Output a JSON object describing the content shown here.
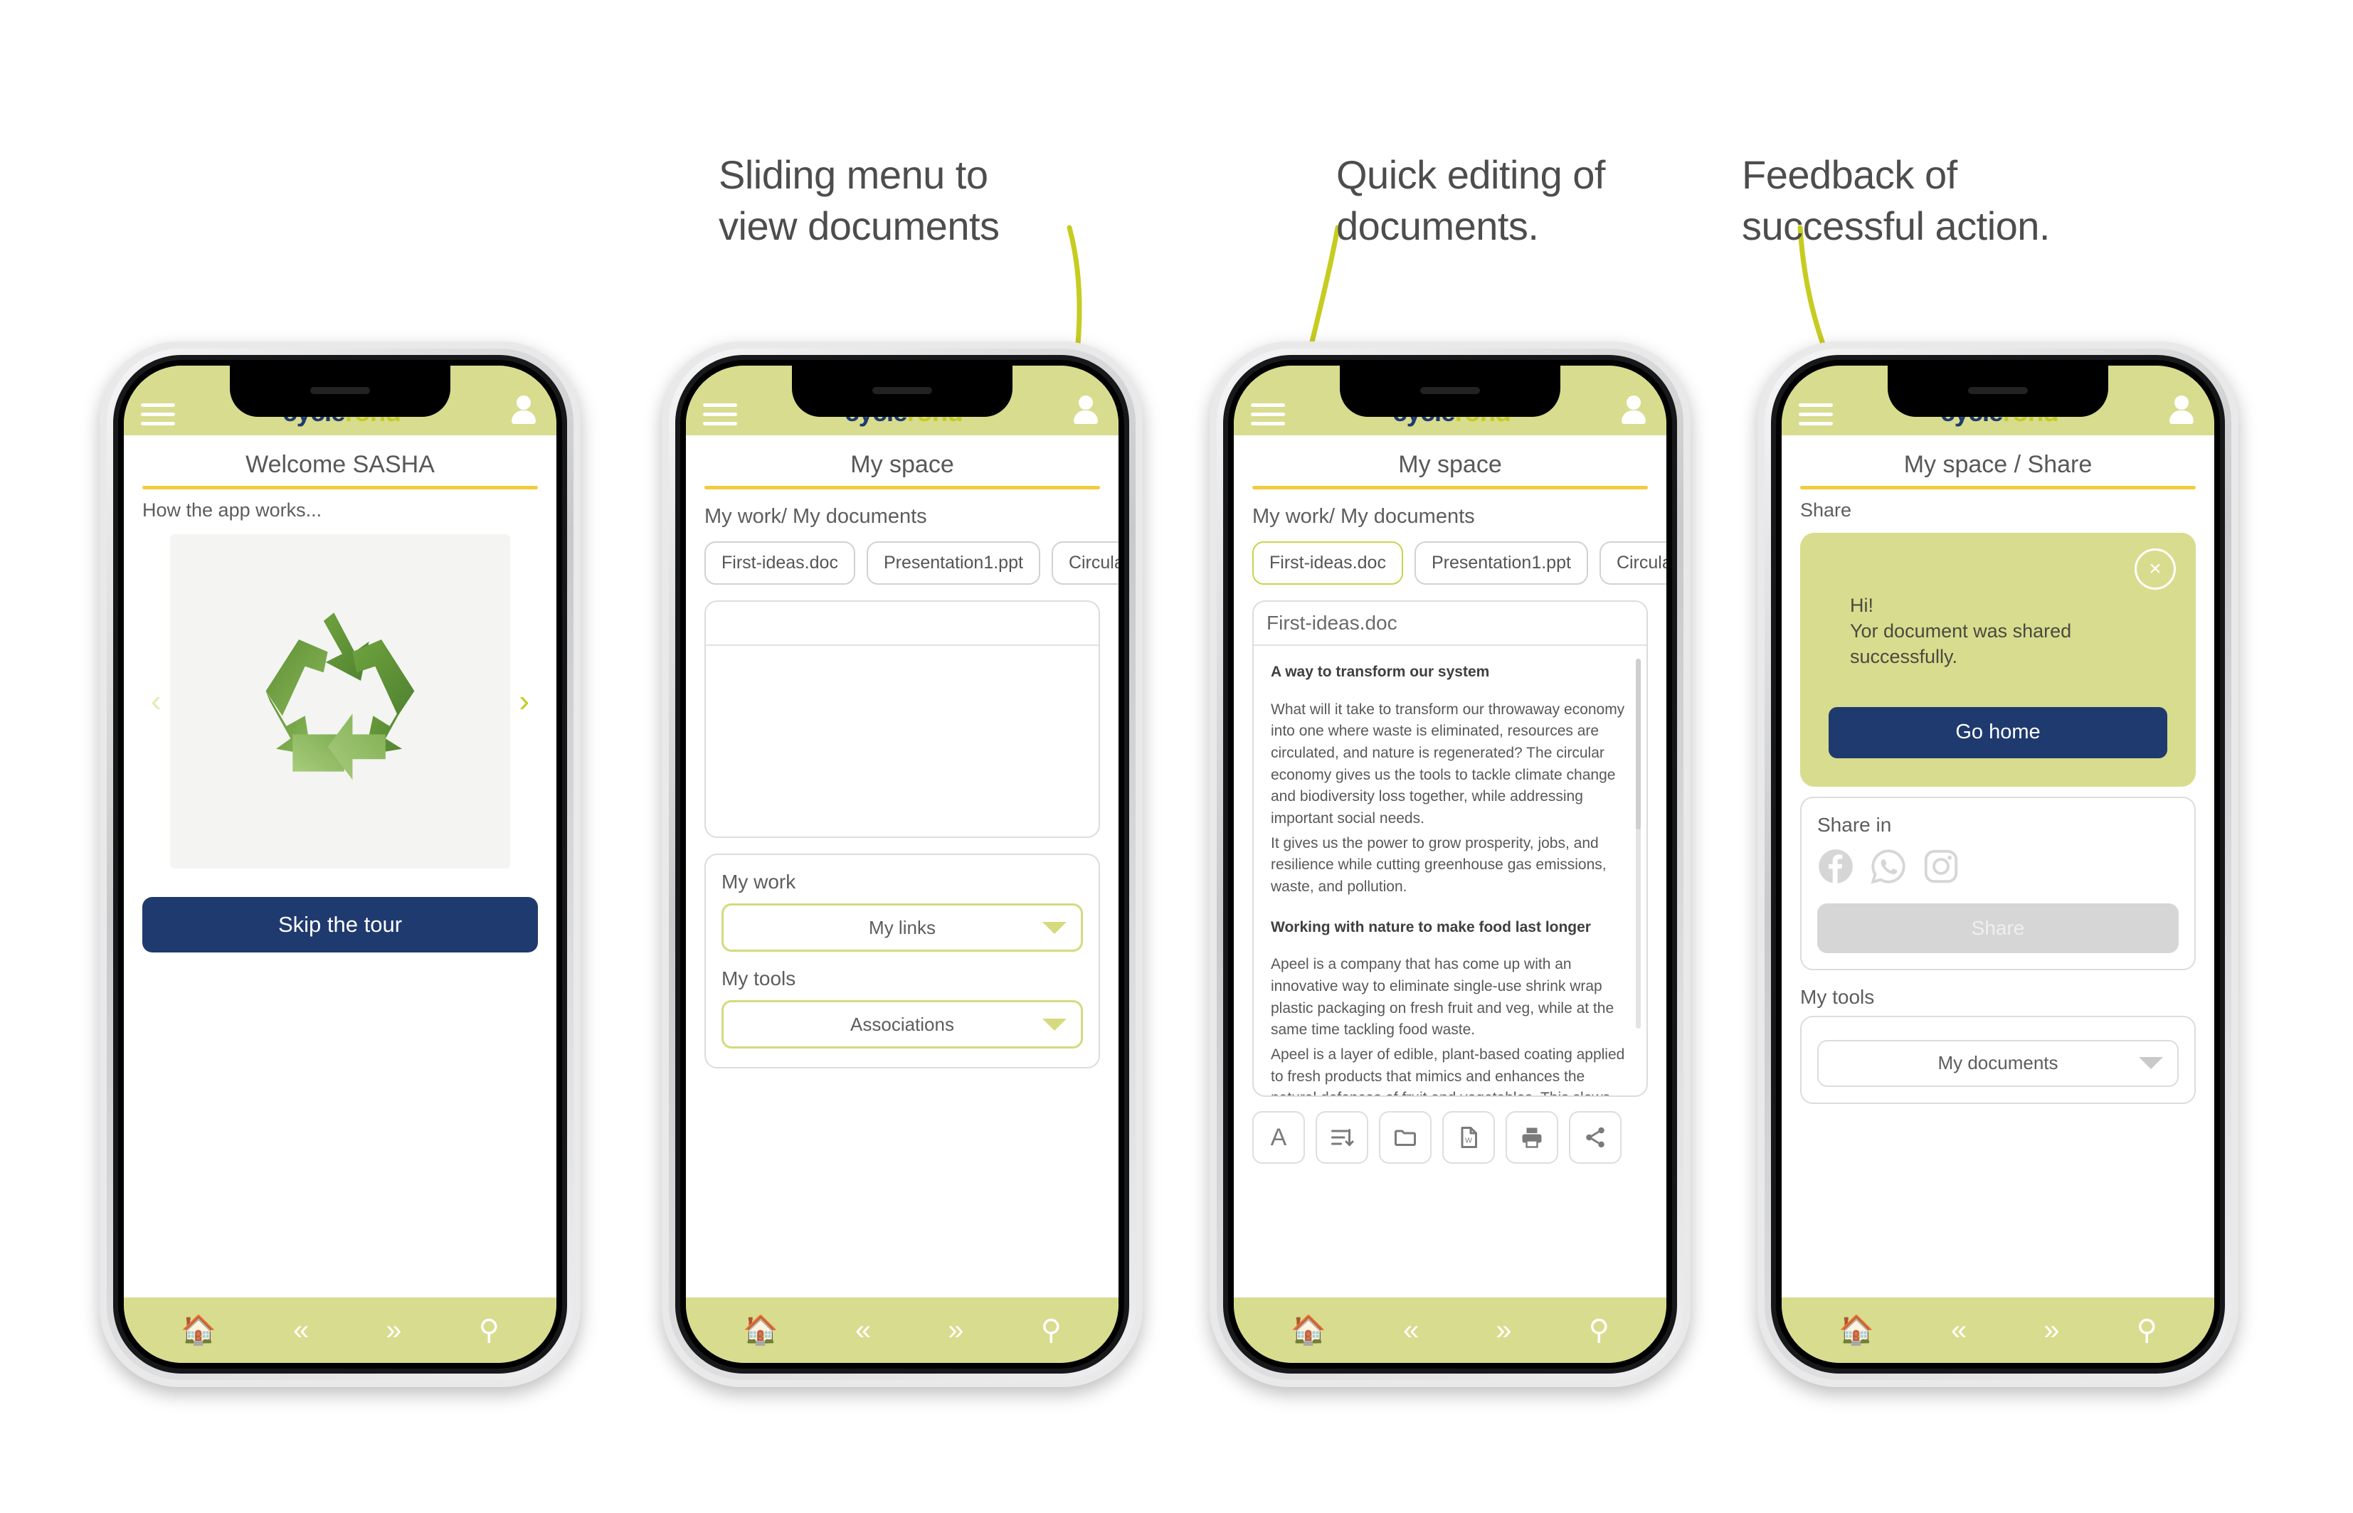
{
  "annotations": [
    {
      "id": "a1",
      "text": "Sliding menu to\nview documents"
    },
    {
      "id": "a2",
      "text": "Quick editing of\ndocuments."
    },
    {
      "id": "a3",
      "text": "Feedback of\nsuccessful action."
    }
  ],
  "brand": {
    "name_part1": "cycle",
    "name_part2": "rond",
    "olive": "#d8dc8e",
    "navy": "#1f3a6e",
    "accent_yellow": "#f3cc3e",
    "logo_olive": "#c6cc20"
  },
  "navbar": {
    "home_icon": "home-icon",
    "prev_icon": "double-chevron-left-icon",
    "next_icon": "double-chevron-right-icon",
    "search_icon": "search-icon"
  },
  "header": {
    "menu_icon": "hamburger-menu-icon",
    "account_icon": "account-avatar-icon"
  },
  "phone1": {
    "title": "Welcome SASHA",
    "subtitle": "How the app works...",
    "prev_arrow": "‹",
    "next_arrow": "›",
    "carousel_image": "recycling-symbol-illustration",
    "skip_button": "Skip the tour"
  },
  "phone2": {
    "title": "My space",
    "breadcrumb": "My work/ My documents",
    "chips": [
      "First-ideas.doc",
      "Presentation1.ppt",
      "Circular-eco"
    ],
    "active_chip_index": -1,
    "work_label": "My work",
    "work_value": "My links",
    "tools_label": "My tools",
    "tools_value": "Associations"
  },
  "phone3": {
    "title": "My space",
    "breadcrumb": "My work/ My documents",
    "chips": [
      "First-ideas.doc",
      "Presentation1.ppt",
      "Circular-eco"
    ],
    "active_chip_index": 0,
    "doc_name": "First-ideas.doc",
    "doc_heading1": "A way to transform our system",
    "doc_para1": "What will it take to transform our throwaway economy into one where waste is eliminated, resources are circulated, and nature is regenerated? The circular economy gives us the tools to tackle climate change and biodiversity loss together, while addressing important social needs.",
    "doc_para2": "It gives us the power to grow prosperity, jobs, and resilience while cutting greenhouse gas emissions, waste, and pollution.",
    "doc_heading2": "Working with nature to make food last longer",
    "doc_para3": "Apeel is a company that has come up with an innovative way to eliminate single-use shrink wrap plastic packaging on fresh fruit and veg, while at the same time tackling food waste.",
    "doc_para4": "Apeel is a layer of edible, plant-based coating applied to fresh products that mimics and enhances the natural defences of fruit and vegetables. This slows down the two main things that cause spoilage – water loss and oxidation.",
    "toolbar": [
      "text-format-icon",
      "sort-lines-icon",
      "folder-icon",
      "word-document-icon",
      "print-icon",
      "share-icon"
    ]
  },
  "phone4": {
    "title": "My space / Share",
    "section_label": "Share",
    "modal_close": "×",
    "modal_text": "Hi!\nYor document was shared\nsuccessfully.",
    "modal_button": "Go home",
    "share_in_label": "Share in",
    "socials": [
      "facebook-icon",
      "whatsapp-icon",
      "instagram-icon"
    ],
    "share_button": "Share",
    "tools_label": "My tools",
    "tools_value": "My documents"
  }
}
